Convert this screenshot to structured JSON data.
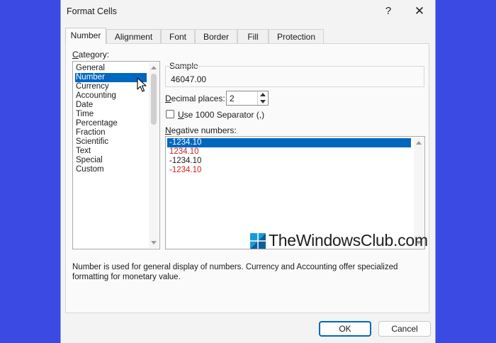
{
  "dialog": {
    "title": "Format Cells",
    "help_glyph": "?",
    "close_glyph": "✕"
  },
  "tabs": [
    {
      "label": "Number",
      "active": true
    },
    {
      "label": "Alignment"
    },
    {
      "label": "Font"
    },
    {
      "label": "Border"
    },
    {
      "label": "Fill"
    },
    {
      "label": "Protection"
    }
  ],
  "category": {
    "label_rest": "ategory:",
    "label_hotkey": "C",
    "items": [
      "General",
      "Number",
      "Currency",
      "Accounting",
      "Date",
      "Time",
      "Percentage",
      "Fraction",
      "Scientific",
      "Text",
      "Special",
      "Custom"
    ],
    "selected": "Number"
  },
  "sample": {
    "label": "Sample",
    "value": "46047.00"
  },
  "decimal_places": {
    "label_hotkey": "D",
    "label_rest": "ecimal places:",
    "value": "2"
  },
  "separator": {
    "label_hotkey": "U",
    "label_rest": "se 1000 Separator (,)",
    "checked": false
  },
  "negative_numbers": {
    "label_hotkey": "N",
    "label_rest": "egative numbers:",
    "items": [
      {
        "text": "-1234.10",
        "color": "#1a1a1a",
        "selected": true
      },
      {
        "text": "1234.10",
        "color": "#d0231c"
      },
      {
        "text": "-1234.10",
        "color": "#1a1a1a"
      },
      {
        "text": "-1234.10",
        "color": "#d0231c"
      }
    ]
  },
  "watermark": "TheWindowsClub.com",
  "description": "Number is used for general display of numbers.  Currency and Accounting offer specialized formatting for monetary value.",
  "buttons": {
    "ok": "OK",
    "cancel": "Cancel"
  },
  "colors": {
    "accent": "#0067c0",
    "background": "#3b4ae3",
    "negative_red": "#d0231c"
  }
}
